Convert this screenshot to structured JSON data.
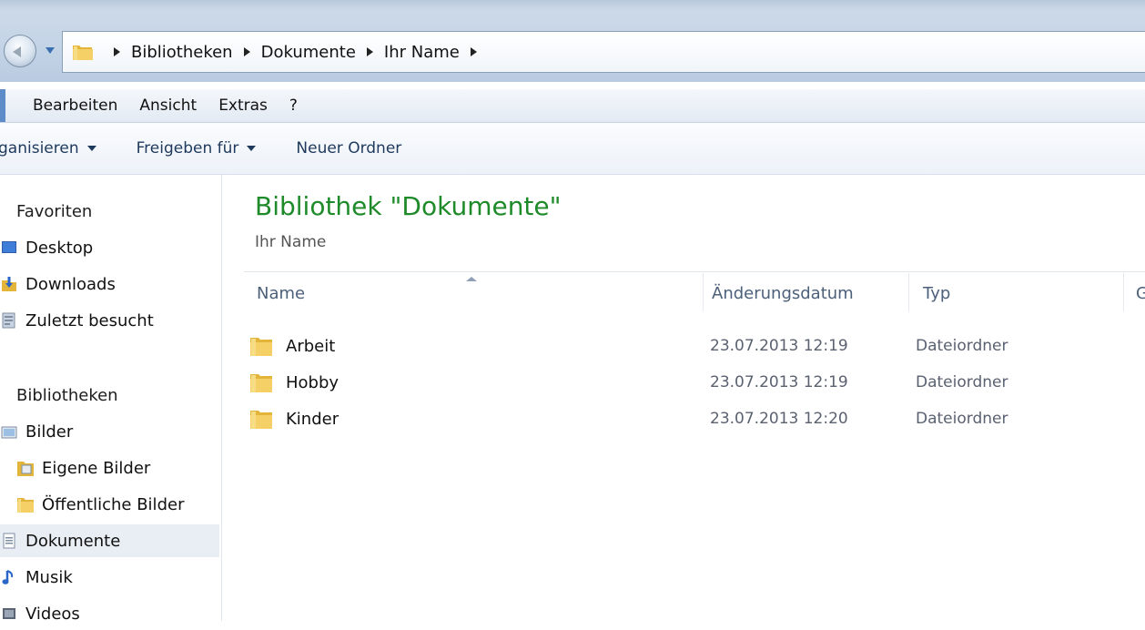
{
  "address_bar": {
    "crumbs": [
      "Bibliotheken",
      "Dokumente",
      "Ihr Name"
    ]
  },
  "menu": {
    "items": [
      "Bearbeiten",
      "Ansicht",
      "Extras",
      "?"
    ]
  },
  "command_bar": {
    "organize_label": "ganisieren",
    "share_label": "Freigeben für",
    "new_folder_label": "Neuer Ordner"
  },
  "nav": {
    "favorites_title": "Favoriten",
    "favorites": [
      {
        "label": "Desktop",
        "icon": "desktop-icon"
      },
      {
        "label": "Downloads",
        "icon": "downloads-icon"
      },
      {
        "label": "Zuletzt besucht",
        "icon": "recent-places-icon"
      }
    ],
    "libraries_title": "Bibliotheken",
    "libraries": [
      {
        "label": "Bilder",
        "icon": "pictures-library-icon"
      },
      {
        "label": "Eigene Bilder",
        "icon": "pictures-folder-icon"
      },
      {
        "label": "Öffentliche Bilder",
        "icon": "folder-icon"
      },
      {
        "label": "Dokumente",
        "icon": "documents-library-icon",
        "selected": true
      },
      {
        "label": "Musik",
        "icon": "music-icon"
      },
      {
        "label": "Videos",
        "icon": "videos-icon"
      }
    ]
  },
  "content": {
    "title": "Bibliothek \"Dokumente\"",
    "subtitle": "Ihr Name",
    "columns": [
      "Name",
      "Änderungsdatum",
      "Typ",
      "G"
    ],
    "files": [
      {
        "name": "Arbeit",
        "date": "23.07.2013 12:19",
        "type": "Dateiordner"
      },
      {
        "name": "Hobby",
        "date": "23.07.2013 12:19",
        "type": "Dateiordner"
      },
      {
        "name": "Kinder",
        "date": "23.07.2013 12:20",
        "type": "Dateiordner"
      }
    ]
  },
  "colors": {
    "title_green": "#1e8a29",
    "header_text": "#4c607a",
    "selection_bg": "#e9eef4",
    "folder_yellow": "#f2c94c"
  }
}
